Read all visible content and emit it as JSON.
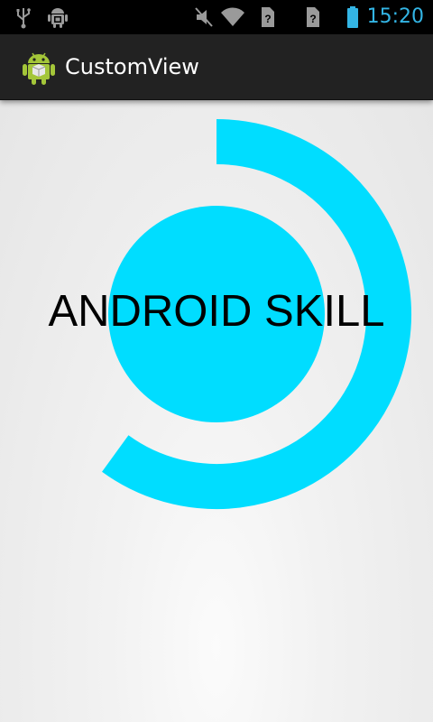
{
  "status_bar": {
    "time": "15:20",
    "icons": [
      "usb-icon",
      "android-debug-icon",
      "mute-icon",
      "wifi-icon",
      "sim-icon",
      "sim2-icon",
      "battery-icon"
    ]
  },
  "action_bar": {
    "title": "CustomView",
    "icon": "android-robot-icon"
  },
  "custom_view": {
    "label": "ANDROID SKILL",
    "accent_color": "#00ddff",
    "progress_fraction": 0.6
  }
}
